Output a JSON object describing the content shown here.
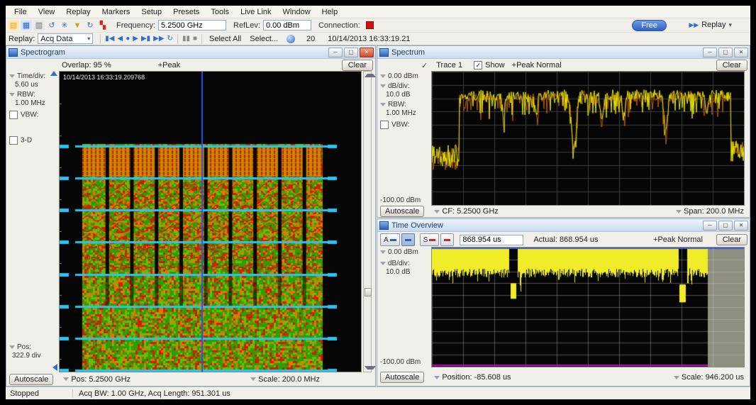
{
  "colors": {
    "plot_bg": "#060606",
    "grid": "#3c3c3c",
    "time_grid": "rgba(215,215,215,0.35)",
    "sg_green": "#2f9e00",
    "sg_green2": "#66c000",
    "sg_orange": "#e07800",
    "sg_red": "#cc2000",
    "sg_cyan": "#2ac4f2",
    "sg_cf": "#2d4fe8",
    "spectrum_yellow": "#e4e400",
    "spectrum_orange": "#b05c14",
    "time_yellow": "#f0ec28",
    "time_magenta": "#cc00cc",
    "time_blue": "#3a5cd8",
    "gray_region": "#8f8f80",
    "connection_red": "#cc1212",
    "accent_blue": "#2f6fd0"
  },
  "app": {
    "menu": [
      "File",
      "View",
      "Replay",
      "Markers",
      "Setup",
      "Presets",
      "Tools",
      "Live Link",
      "Window",
      "Help"
    ],
    "toolbar_icons": [
      {
        "name": "open-folder-icon",
        "glyph": "▤",
        "color": "#e8a20f",
        "bg": "#fce9b8"
      },
      {
        "name": "save-icon",
        "glyph": "▦",
        "color": "#2f62c4",
        "bg": "#d8e4f8"
      },
      {
        "name": "print-icon",
        "glyph": "▥",
        "color": "#6a6f76",
        "bg": "#e7e7e3"
      },
      {
        "name": "undo-icon",
        "glyph": "↺",
        "color": "#3a6fc4",
        "bg": "transparent"
      },
      {
        "name": "settings-icon",
        "glyph": "✳",
        "color": "#2f62c4",
        "bg": "transparent"
      },
      {
        "name": "amplitude-icon",
        "glyph": "▼",
        "color": "#caa21a",
        "bg": "transparent"
      },
      {
        "name": "acquire-icon",
        "glyph": "↻",
        "color": "#3a6fc4",
        "bg": "transparent"
      },
      {
        "name": "markers-icon",
        "glyph": "▚",
        "color": "#cc2a1a",
        "bg": "transparent"
      }
    ],
    "toolbar": {
      "frequency_label": "Frequency:",
      "frequency_value": "5.2500 GHz",
      "reflev_label": "RefLev:",
      "reflev_value": "0.00 dBm",
      "connection_label": "Connection:",
      "free_button": "Free",
      "replay_button": "Replay",
      "replay_arrows": "▶▶",
      "caret": "▾"
    },
    "replay_bar": {
      "label": "Replay:",
      "source": "Acq Data",
      "caret": "▾",
      "transport": [
        {
          "name": "replay-skip-start-button",
          "glyph": "▮◀"
        },
        {
          "name": "replay-step-back-button",
          "glyph": "◀"
        },
        {
          "name": "replay-record-button",
          "glyph": "●"
        },
        {
          "name": "replay-play-button",
          "glyph": "▶"
        },
        {
          "name": "replay-step-forward-button",
          "glyph": "▶▮"
        },
        {
          "name": "replay-fast-forward-button",
          "glyph": "▶▶"
        },
        {
          "name": "replay-loop-button",
          "glyph": "↻"
        }
      ],
      "pause_glyph": "▮▮",
      "stop_glyph": "■",
      "select_all": "Select All",
      "select": "Select...",
      "count": "20",
      "timestamp": "10/14/2013 16:33:19.21"
    },
    "status_bar": {
      "state": "Stopped",
      "info": "Acq BW: 1.00 GHz, Acq Length: 951.301 us"
    }
  },
  "spectrogram": {
    "title": "Spectrogram",
    "overlap_label": "Overlap: 95 %",
    "detector": "+Peak",
    "clear_button": "Clear",
    "sidebar": {
      "time_div_label": "Time/div:",
      "time_div_value": "5.60 us",
      "rbw_label": "RBW:",
      "rbw_value": "1.00 MHz",
      "vbw_label": "VBW:",
      "threed_label": "3-D",
      "pos_label": "Pos:",
      "pos_value": "322.9 div"
    },
    "plot": {
      "timestamp": "10/14/2013 16:33:19.209768"
    },
    "bottom": {
      "autoscale": "Autoscale",
      "pos_label": "Pos:",
      "pos_value": "5.2500 GHz",
      "scale_label": "Scale:",
      "scale_value": "200.0 MHz"
    }
  },
  "spectrum": {
    "title": "Spectrum",
    "trace_check": "✓",
    "trace_label": "Trace 1",
    "show_label": "Show",
    "show_check": "✓",
    "detector": "+Peak Normal",
    "clear_button": "Clear",
    "sidebar": {
      "top_ref": "0.00 dBm",
      "db_div_label": "dB/div:",
      "db_div_value": "10.0 dB",
      "rbw_label": "RBW:",
      "rbw_value": "1.00 MHz",
      "vbw_label": "VBW:",
      "bottom_ref": "-100.00 dBm"
    },
    "bottom": {
      "autoscale": "Autoscale",
      "cf_label": "CF:",
      "cf_value": "5.2500 GHz",
      "span_label": "Span:",
      "span_value": "200.0 MHz"
    }
  },
  "time_overview": {
    "title": "Time Overview",
    "toolbar": {
      "a_label": "A",
      "s_label": "S",
      "length_value": "868.954 us",
      "actual_label": "Actual:",
      "actual_value": "868.954 us",
      "detector": "+Peak Normal",
      "clear_button": "Clear"
    },
    "sidebar": {
      "top_ref": "0.00 dBm",
      "db_div_label": "dB/div:",
      "db_div_value": "10.0 dB",
      "bottom_ref": "-100.00 dBm"
    },
    "bottom": {
      "autoscale": "Autoscale",
      "position_label": "Position:",
      "position_value": "-85.608 us",
      "scale_label": "Scale:",
      "scale_value": "946.200 us"
    }
  },
  "chart_data": [
    {
      "type": "heatmap",
      "title": "Spectrogram",
      "x_center": "5.2500 GHz",
      "x_scale_per_div": "200.0 MHz",
      "time_per_div": "5.60 us",
      "rbw": "1.00 MHz",
      "overlap_pct": 95,
      "detector": "+Peak",
      "pos_div": 322.9,
      "note": "Burst signal ~80% of span occupying lower 76% of record; black (idle) at top; cyan time-division markers every division; blue CF marker line at center span"
    },
    {
      "type": "line",
      "title": "Spectrum",
      "ylim_dbm": [
        -100,
        0
      ],
      "db_per_div": 10,
      "cf": "5.2500 GHz",
      "span": "200.0 MHz",
      "rbw": "1.00 MHz",
      "detector": "+Peak Normal",
      "traces": [
        "Trace 1 (+Peak, yellow)",
        "Trace (orange)"
      ],
      "note": "Noisy plateau ~-15 to -25 dBm across ~85% of span with deep notches near mid-span (to ~-55 dBm); noise floor ~-60 dBm at band edges"
    },
    {
      "type": "area",
      "title": "Time Overview",
      "ylim_dbm": [
        -100,
        0
      ],
      "db_per_div": 10,
      "position": "-85.608 us",
      "scale": "946.200 us",
      "analysis_length": "868.954 us",
      "detector": "+Peak Normal",
      "note": "Amplitude ~-5..-20 dBm over full record with two short dropouts (~25% and ~80% of record) reaching ~-50 dBm; right ~12% beyond acquisition shown gray; magenta floor line at bottom; blue analysis-length bar at top"
    }
  ]
}
